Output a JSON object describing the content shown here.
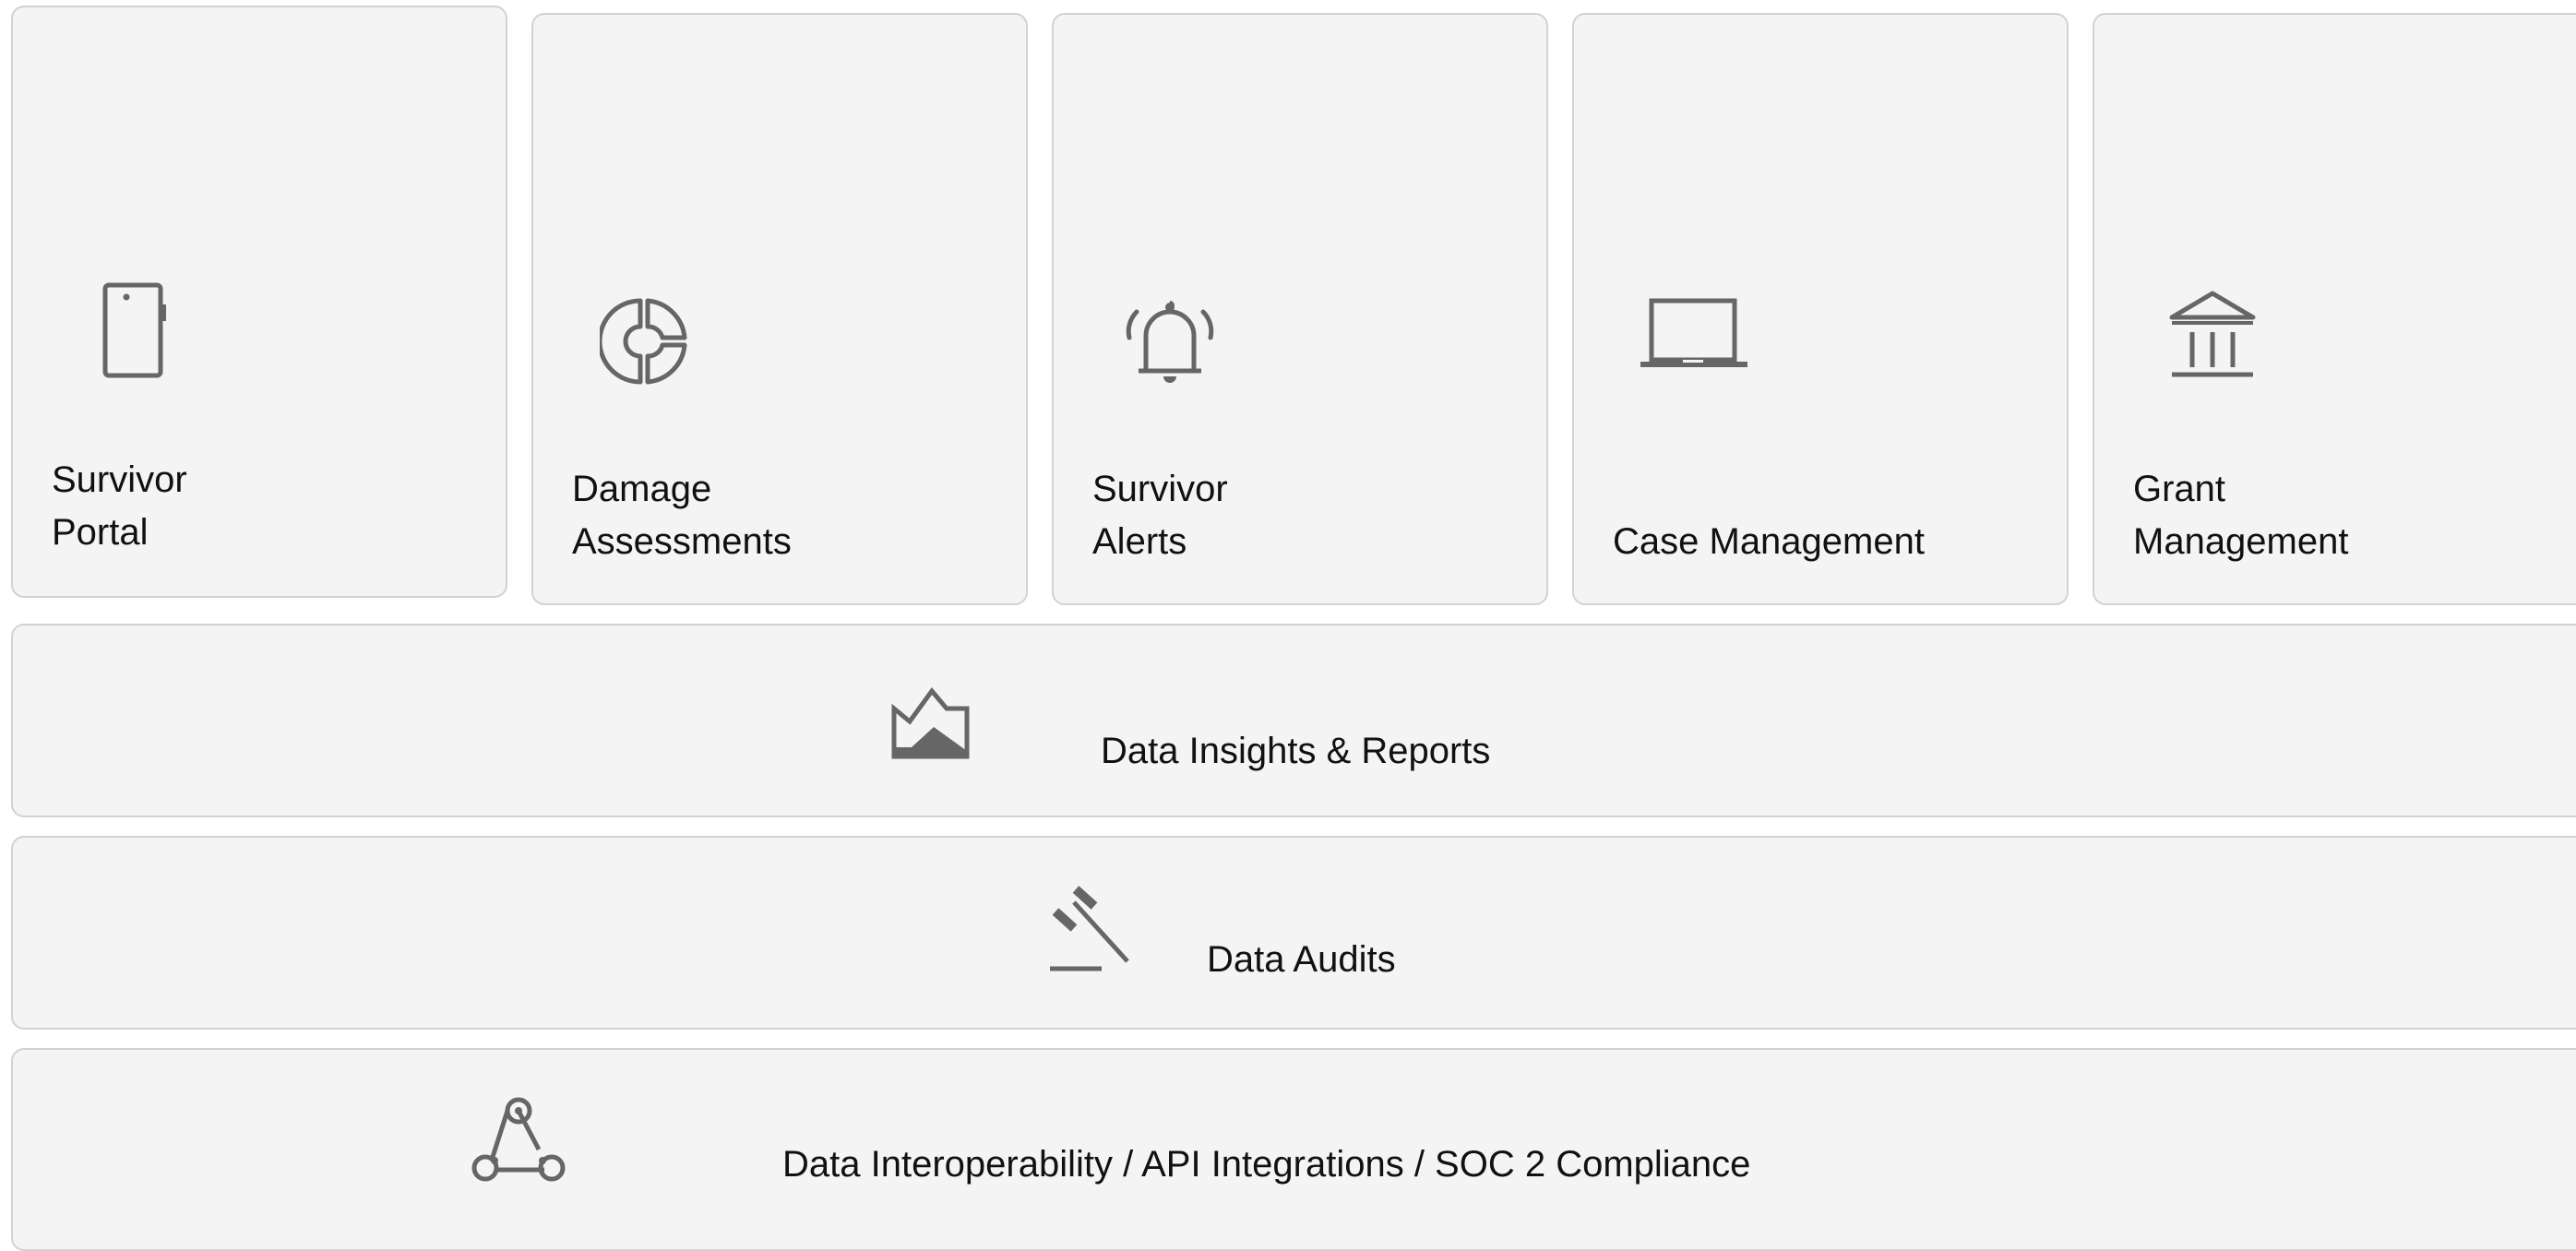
{
  "modules": [
    {
      "lines": [
        "Survivor",
        "Portal"
      ],
      "icon": "mobile-phone-icon"
    },
    {
      "lines": [
        "Damage",
        "Assessments"
      ],
      "icon": "pie-chart-icon"
    },
    {
      "lines": [
        "Survivor",
        "Alerts"
      ],
      "icon": "bell-icon"
    },
    {
      "lines": [
        "Case Management"
      ],
      "icon": "laptop-icon"
    },
    {
      "lines": [
        "Grant",
        "Management"
      ],
      "icon": "bank-building-icon"
    }
  ],
  "layers": [
    {
      "label": "Data Insights & Reports",
      "icon": "landscape-chart-icon"
    },
    {
      "label": "Data Audits",
      "icon": "gavel-icon"
    },
    {
      "label": "Data Interoperability / API Integrations / SOC 2 Compliance",
      "icon": "webhook-icon"
    }
  ],
  "colors": {
    "card_background": "#f4f4f4",
    "card_border": "#d2d2d2",
    "icon": "#666666"
  }
}
